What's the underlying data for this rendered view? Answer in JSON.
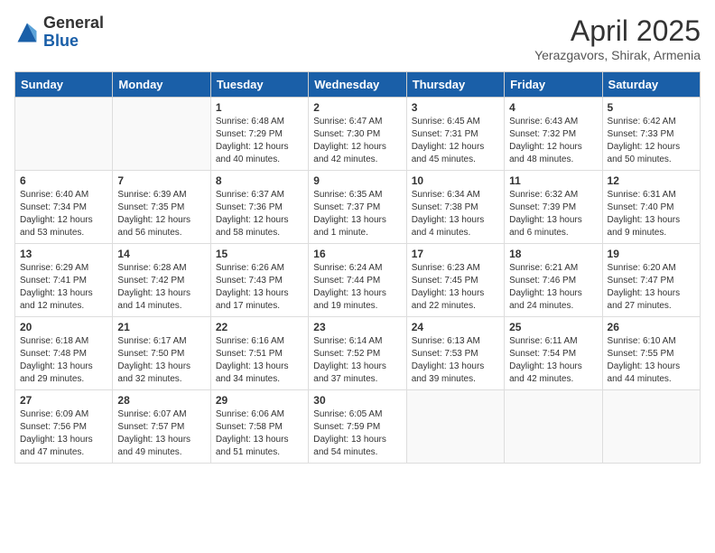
{
  "logo": {
    "general": "General",
    "blue": "Blue"
  },
  "title": "April 2025",
  "subtitle": "Yerazgavors, Shirak, Armenia",
  "days_of_week": [
    "Sunday",
    "Monday",
    "Tuesday",
    "Wednesday",
    "Thursday",
    "Friday",
    "Saturday"
  ],
  "weeks": [
    [
      {
        "num": "",
        "info": ""
      },
      {
        "num": "",
        "info": ""
      },
      {
        "num": "1",
        "info": "Sunrise: 6:48 AM\nSunset: 7:29 PM\nDaylight: 12 hours and 40 minutes."
      },
      {
        "num": "2",
        "info": "Sunrise: 6:47 AM\nSunset: 7:30 PM\nDaylight: 12 hours and 42 minutes."
      },
      {
        "num": "3",
        "info": "Sunrise: 6:45 AM\nSunset: 7:31 PM\nDaylight: 12 hours and 45 minutes."
      },
      {
        "num": "4",
        "info": "Sunrise: 6:43 AM\nSunset: 7:32 PM\nDaylight: 12 hours and 48 minutes."
      },
      {
        "num": "5",
        "info": "Sunrise: 6:42 AM\nSunset: 7:33 PM\nDaylight: 12 hours and 50 minutes."
      }
    ],
    [
      {
        "num": "6",
        "info": "Sunrise: 6:40 AM\nSunset: 7:34 PM\nDaylight: 12 hours and 53 minutes."
      },
      {
        "num": "7",
        "info": "Sunrise: 6:39 AM\nSunset: 7:35 PM\nDaylight: 12 hours and 56 minutes."
      },
      {
        "num": "8",
        "info": "Sunrise: 6:37 AM\nSunset: 7:36 PM\nDaylight: 12 hours and 58 minutes."
      },
      {
        "num": "9",
        "info": "Sunrise: 6:35 AM\nSunset: 7:37 PM\nDaylight: 13 hours and 1 minute."
      },
      {
        "num": "10",
        "info": "Sunrise: 6:34 AM\nSunset: 7:38 PM\nDaylight: 13 hours and 4 minutes."
      },
      {
        "num": "11",
        "info": "Sunrise: 6:32 AM\nSunset: 7:39 PM\nDaylight: 13 hours and 6 minutes."
      },
      {
        "num": "12",
        "info": "Sunrise: 6:31 AM\nSunset: 7:40 PM\nDaylight: 13 hours and 9 minutes."
      }
    ],
    [
      {
        "num": "13",
        "info": "Sunrise: 6:29 AM\nSunset: 7:41 PM\nDaylight: 13 hours and 12 minutes."
      },
      {
        "num": "14",
        "info": "Sunrise: 6:28 AM\nSunset: 7:42 PM\nDaylight: 13 hours and 14 minutes."
      },
      {
        "num": "15",
        "info": "Sunrise: 6:26 AM\nSunset: 7:43 PM\nDaylight: 13 hours and 17 minutes."
      },
      {
        "num": "16",
        "info": "Sunrise: 6:24 AM\nSunset: 7:44 PM\nDaylight: 13 hours and 19 minutes."
      },
      {
        "num": "17",
        "info": "Sunrise: 6:23 AM\nSunset: 7:45 PM\nDaylight: 13 hours and 22 minutes."
      },
      {
        "num": "18",
        "info": "Sunrise: 6:21 AM\nSunset: 7:46 PM\nDaylight: 13 hours and 24 minutes."
      },
      {
        "num": "19",
        "info": "Sunrise: 6:20 AM\nSunset: 7:47 PM\nDaylight: 13 hours and 27 minutes."
      }
    ],
    [
      {
        "num": "20",
        "info": "Sunrise: 6:18 AM\nSunset: 7:48 PM\nDaylight: 13 hours and 29 minutes."
      },
      {
        "num": "21",
        "info": "Sunrise: 6:17 AM\nSunset: 7:50 PM\nDaylight: 13 hours and 32 minutes."
      },
      {
        "num": "22",
        "info": "Sunrise: 6:16 AM\nSunset: 7:51 PM\nDaylight: 13 hours and 34 minutes."
      },
      {
        "num": "23",
        "info": "Sunrise: 6:14 AM\nSunset: 7:52 PM\nDaylight: 13 hours and 37 minutes."
      },
      {
        "num": "24",
        "info": "Sunrise: 6:13 AM\nSunset: 7:53 PM\nDaylight: 13 hours and 39 minutes."
      },
      {
        "num": "25",
        "info": "Sunrise: 6:11 AM\nSunset: 7:54 PM\nDaylight: 13 hours and 42 minutes."
      },
      {
        "num": "26",
        "info": "Sunrise: 6:10 AM\nSunset: 7:55 PM\nDaylight: 13 hours and 44 minutes."
      }
    ],
    [
      {
        "num": "27",
        "info": "Sunrise: 6:09 AM\nSunset: 7:56 PM\nDaylight: 13 hours and 47 minutes."
      },
      {
        "num": "28",
        "info": "Sunrise: 6:07 AM\nSunset: 7:57 PM\nDaylight: 13 hours and 49 minutes."
      },
      {
        "num": "29",
        "info": "Sunrise: 6:06 AM\nSunset: 7:58 PM\nDaylight: 13 hours and 51 minutes."
      },
      {
        "num": "30",
        "info": "Sunrise: 6:05 AM\nSunset: 7:59 PM\nDaylight: 13 hours and 54 minutes."
      },
      {
        "num": "",
        "info": ""
      },
      {
        "num": "",
        "info": ""
      },
      {
        "num": "",
        "info": ""
      }
    ]
  ]
}
